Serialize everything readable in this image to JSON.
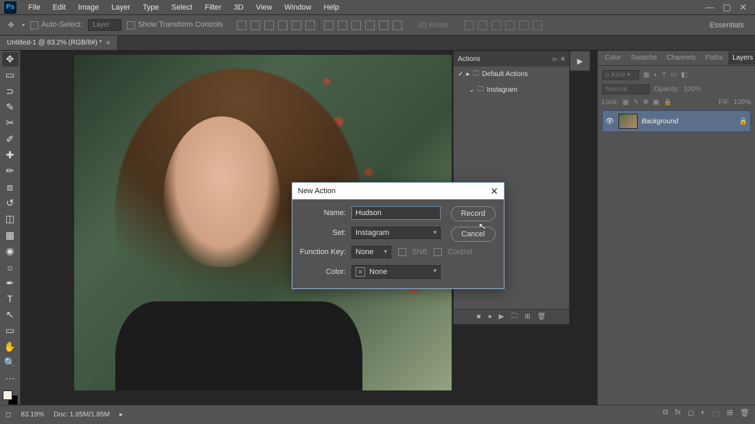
{
  "app": {
    "logo": "Ps"
  },
  "menus": [
    "File",
    "Edit",
    "Image",
    "Layer",
    "Type",
    "Select",
    "Filter",
    "3D",
    "View",
    "Window",
    "Help"
  ],
  "optionsbar": {
    "auto_select": "Auto-Select:",
    "layer_dd": "Layer",
    "show_transform": "Show Transform Controls",
    "mode_label": "3D Mode:",
    "workspace": "Essentials"
  },
  "document_tab": {
    "title": "Untitled-1 @ 83.2% (RGB/8#) *"
  },
  "actions_panel": {
    "title": "Actions",
    "items": [
      {
        "checked": true,
        "folder": true,
        "label": "Default Actions"
      },
      {
        "checked": false,
        "folder": true,
        "label": "Instagram",
        "indent": true
      }
    ]
  },
  "right_panel": {
    "tabs": [
      "Color",
      "Swatche",
      "Channels",
      "Paths",
      "Layers"
    ],
    "active_tab": "Layers",
    "kind_placeholder": "Kind",
    "blend_mode": "Normal",
    "opacity_label": "Opacity:",
    "opacity_value": "100%",
    "lock_label": "Lock:",
    "fill_label": "Fill:",
    "fill_value": "100%",
    "layer_name": "Background"
  },
  "dialog": {
    "title": "New Action",
    "labels": {
      "name": "Name:",
      "set": "Set:",
      "fkey": "Function Key:",
      "color": "Color:"
    },
    "name_value": "Hudson",
    "set_value": "Instagram",
    "fkey_value": "None",
    "shift_label": "Shift",
    "control_label": "Control",
    "color_value": "None",
    "record_btn": "Record",
    "cancel_btn": "Cancel"
  },
  "statusbar": {
    "zoom": "83.19%",
    "doc_info": "Doc: 1.85M/1.85M"
  }
}
